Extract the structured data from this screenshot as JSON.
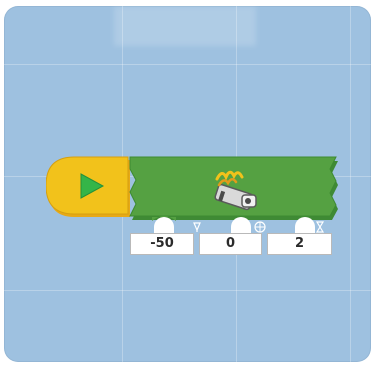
{
  "block": {
    "start_button_icon": "play-triangle-icon",
    "motor_icon": "motor-icon",
    "parameters": [
      {
        "icon": "power-icon",
        "value": "-50"
      },
      {
        "icon": "motor-port-icon",
        "value": "0"
      },
      {
        "icon": "hourglass-icon",
        "value": "2"
      }
    ]
  },
  "colors": {
    "canvas_background": "#9ec1e0",
    "start_block": "#f2c21b",
    "play_triangle": "#35b548",
    "action_block": "#55a142",
    "parameter_box": "#ffffff"
  }
}
